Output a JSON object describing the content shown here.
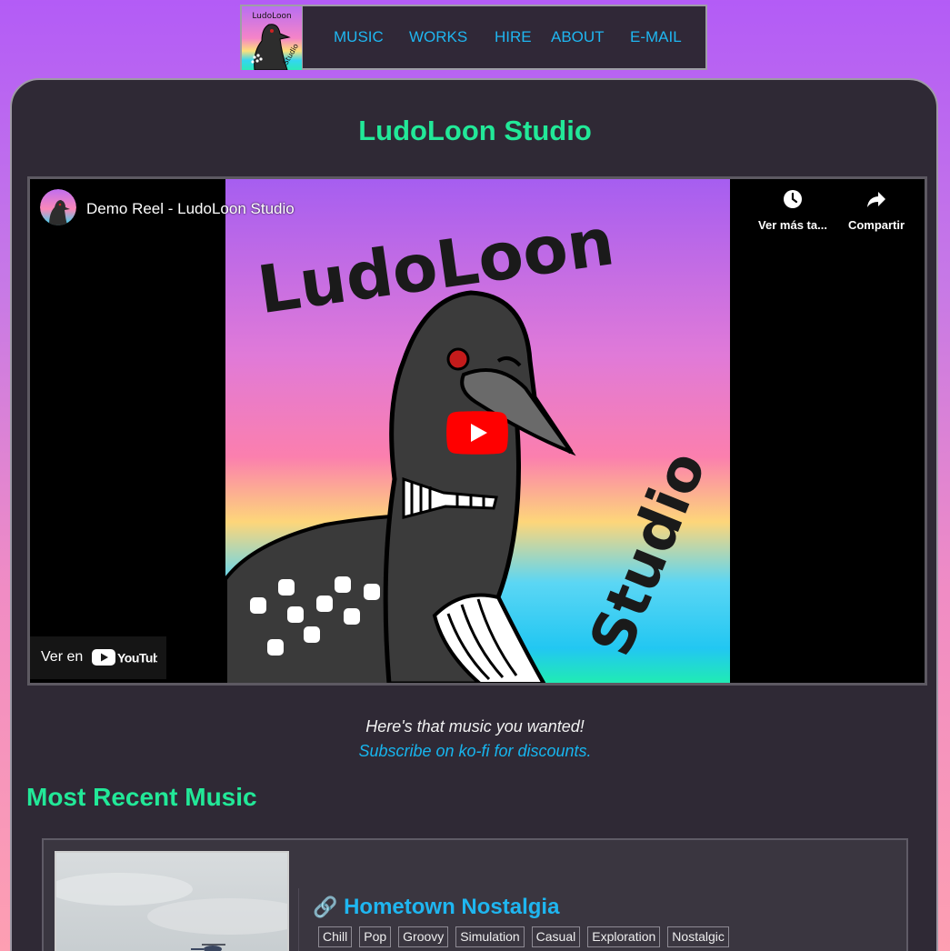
{
  "nav": {
    "logo_text_top": "LudoLoon",
    "logo_text_side": "Studio",
    "items": [
      {
        "label": "MUSIC"
      },
      {
        "label": "WORKS"
      },
      {
        "label": "HIRE"
      },
      {
        "label": "ABOUT"
      },
      {
        "label": "E-MAIL"
      }
    ]
  },
  "header": {
    "title": "LudoLoon Studio"
  },
  "video": {
    "title": "Demo Reel - LudoLoon Studio",
    "watch_later": "Ver más ta...",
    "share": "Compartir",
    "watch_on": "Ver en",
    "youtube": "YouTube",
    "thumbnail_text_top": "LudoLoon",
    "thumbnail_text_side": "Studio"
  },
  "intro": {
    "tagline": "Here's that music you wanted!",
    "kofi": "Subscribe on ko-fi for discounts."
  },
  "recent": {
    "heading": "Most Recent Music",
    "track": {
      "title": "Hometown Nostalgia",
      "tags": [
        "Chill",
        "Pop",
        "Groovy",
        "Simulation",
        "Casual",
        "Exploration",
        "Nostalgic"
      ]
    }
  },
  "colors": {
    "accent_green": "#22e898",
    "accent_blue": "#1fb6f0",
    "card_bg": "#2f2935",
    "youtube_red": "#ff0000"
  }
}
